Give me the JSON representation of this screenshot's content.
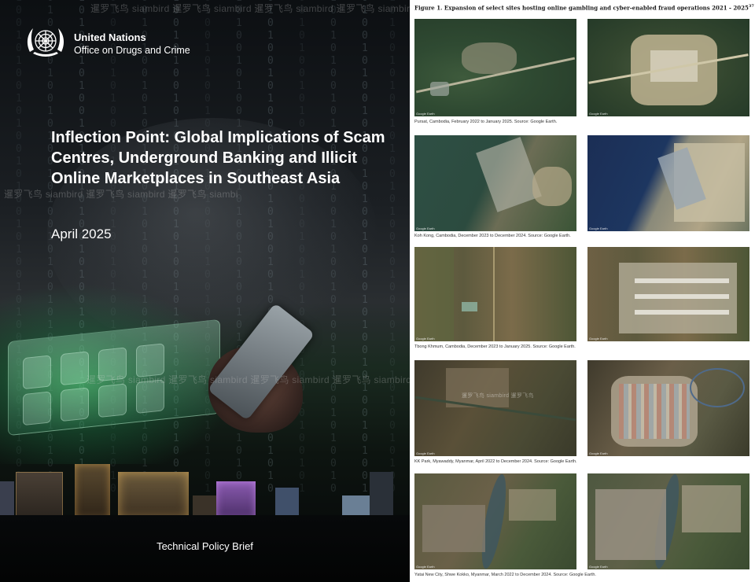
{
  "cover": {
    "org_line1": "United Nations",
    "org_line2": "Office on Drugs and Crime",
    "title": "Inflection Point: Global Implications of Scam Centres, Underground Banking and Illicit Online Marketplaces in Southeast Asia",
    "date": "April 2025",
    "series": "Technical Policy Brief",
    "watermark_1": "暹罗飞鸟 siambird 暹罗飞鸟 siambird 暹罗飞鸟 siambird 暹罗飞鸟 siambird",
    "watermark_2": "暹罗飞鸟 siambird 暹罗飞鸟 siambird 暹罗飞鸟 siambi",
    "watermark_3": "暹罗飞鸟 siambird 暹罗飞鸟 siambird 暹罗飞鸟 siambird 暹罗飞鸟 siambird 暹罗飞鸟",
    "logo": "un-emblem-icon"
  },
  "figure": {
    "title": "Figure 1. Expansion of select sites hosting online gambling and cyber-enabled fraud operations 2021 - 2025",
    "title_note": "37",
    "image_credit": "Google Earth",
    "watermark": "暹罗飞鸟 siambird 暹罗飞鸟",
    "sites": [
      {
        "caption": "Pursat, Cambodia, February 2022 to January 2025. Source: Google Earth."
      },
      {
        "caption": "Koh Kong, Cambodia, December 2023 to December 2024. Source: Google Earth."
      },
      {
        "caption": "Tbong Khmum, Cambodia, December 2023 to January 2025. Source: Google Earth."
      },
      {
        "caption": "KK Park, Myawaddy, Myanmar, April 2022 to December 2024. Source: Google Earth."
      },
      {
        "caption": "Yatai New City, Shwe Kokko, Myanmar, March 2022 to December 2024. Source: Google Earth."
      }
    ]
  },
  "colors": {
    "cover_bg": "#14181b",
    "glow_green": "#3cdc6e",
    "text_white": "#ffffff"
  }
}
